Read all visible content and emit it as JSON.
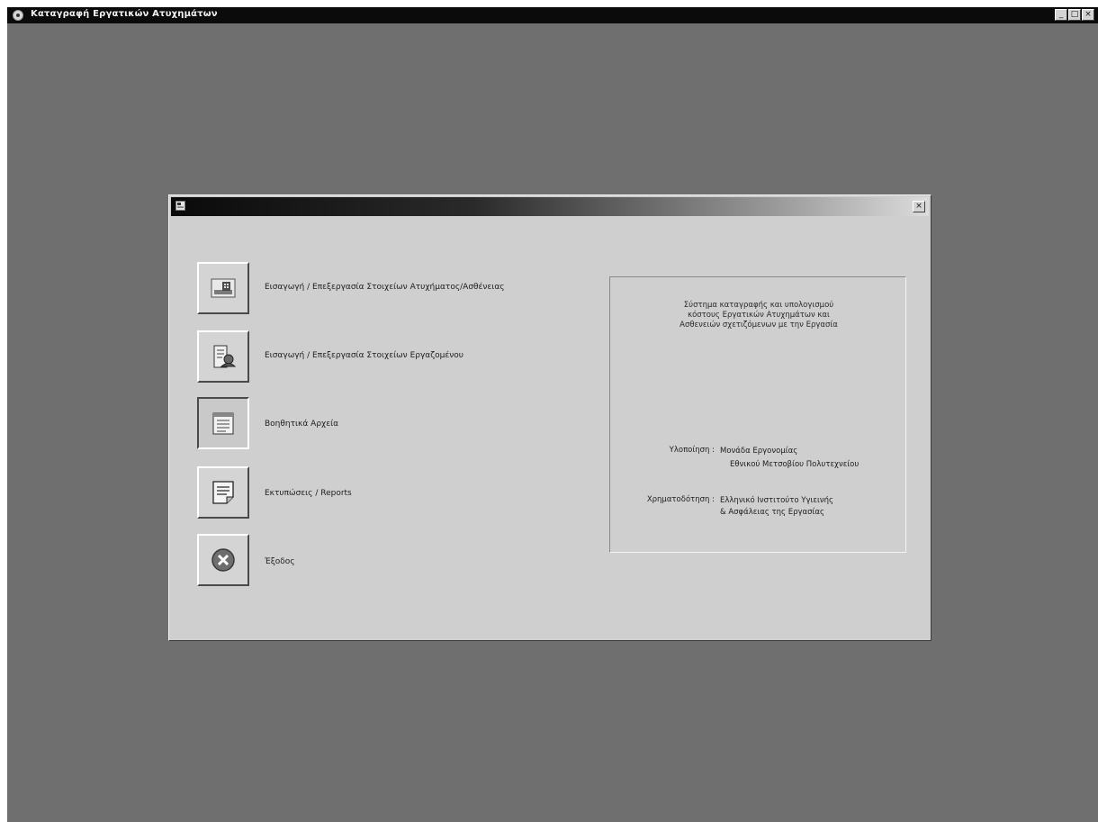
{
  "app": {
    "title": "Καταγραφή Εργατικών Ατυχημάτων",
    "controls": {
      "minimize": "_",
      "maximize": "□",
      "close": "×"
    }
  },
  "dialog": {
    "close": "×",
    "menu": [
      {
        "icon": "accident-data-icon",
        "label": "Εισαγωγή / Επεξεργασία Στοιχείων Ατυχήματος/Ασθένειας"
      },
      {
        "icon": "employee-data-icon",
        "label": "Εισαγωγή / Επεξεργασία Στοιχείων Εργαζομένου"
      },
      {
        "icon": "auxiliary-files-icon",
        "label": "Βοηθητικά Αρχεία"
      },
      {
        "icon": "printouts-reports-icon",
        "label": "Εκτυπώσεις / Reports"
      },
      {
        "icon": "exit-icon",
        "label": "Έξοδος"
      }
    ],
    "info": {
      "description": [
        "Σύστημα καταγραφής και υπολογισμού",
        "κόστους Εργατικών Ατυχημάτων και",
        "Ασθενειών σχετιζόμενων με την Εργασία"
      ],
      "implementation_label": "Υλοποίηση :",
      "implementation_lines": [
        "Μονάδα Εργονομίας",
        "Εθνικού Μετσοβίου Πολυτεχνείου"
      ],
      "funding_label": "Χρηματοδότηση :",
      "funding_lines": [
        "Ελληνικό Ινστιτούτο Υγιεινής",
        "& Ασφάλειας της Εργασίας"
      ]
    }
  }
}
